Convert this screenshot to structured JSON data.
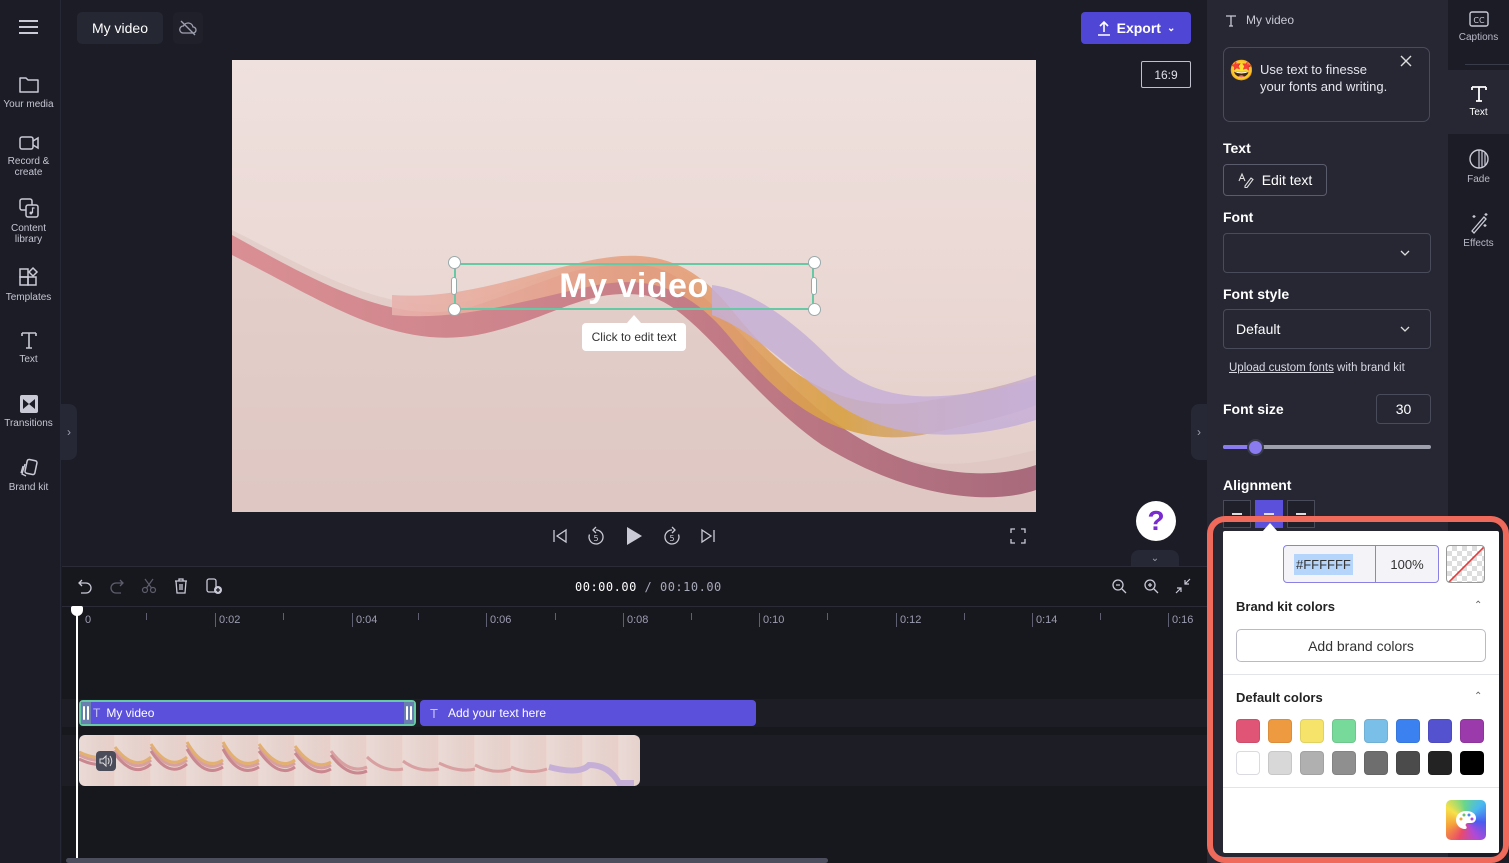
{
  "topbar": {
    "project_title": "My video",
    "cloud_status_icon": "cloud-off-icon",
    "export_label": "Export",
    "aspect_ratio": "16:9"
  },
  "leftnav": {
    "menu_icon": "hamburger-icon",
    "items": [
      {
        "label": "Your media",
        "icon": "folder-icon"
      },
      {
        "label": "Record & create",
        "icon": "video-camera-icon"
      },
      {
        "label": "Content library",
        "icon": "content-library-icon"
      },
      {
        "label": "Templates",
        "icon": "templates-icon"
      },
      {
        "label": "Text",
        "icon": "text-icon"
      },
      {
        "label": "Transitions",
        "icon": "transitions-icon"
      },
      {
        "label": "Brand kit",
        "icon": "brand-kit-icon"
      }
    ]
  },
  "preview": {
    "overlay_text": "My video",
    "tooltip": "Click to edit text"
  },
  "player": {
    "help_label": "?"
  },
  "timeline": {
    "current_time": "00:00.00",
    "total_time": "/ 00:10.00",
    "ruler_labels": [
      "0",
      "0:02",
      "0:04",
      "0:06",
      "0:08",
      "0:10",
      "0:12",
      "0:14",
      "0:16"
    ],
    "clips": {
      "text_clip_1": "My video",
      "text_clip_2": "Add your text here"
    }
  },
  "right_panel": {
    "header_title": "My video",
    "info_card_text": "Use text to finesse your fonts and writing.",
    "text_section_label": "Text",
    "edit_text_label": "Edit text",
    "font_label": "Font",
    "font_value": "",
    "font_style_label": "Font style",
    "font_style_value": "Default",
    "upload_fonts_link": "Upload custom fonts",
    "upload_fonts_suffix": " with brand kit",
    "font_size_label": "Font size",
    "font_size_value": "30",
    "font_size_slider_fraction": 0.16,
    "alignment_label": "Alignment",
    "alignment_selected": "center"
  },
  "right_tabs": [
    {
      "label": "Captions",
      "icon": "captions-icon",
      "active": false
    },
    {
      "label": "Text",
      "icon": "text-icon",
      "active": true
    },
    {
      "label": "Fade",
      "icon": "fade-icon",
      "active": false
    },
    {
      "label": "Effects",
      "icon": "effects-wand-icon",
      "active": false
    }
  ],
  "color_picker": {
    "hex_value": "#FFFFFF",
    "opacity_value": "100%",
    "brand_kit_title": "Brand kit colors",
    "add_brand_colors_label": "Add brand colors",
    "default_colors_title": "Default colors",
    "default_colors": [
      "#E05475",
      "#EE9A40",
      "#F5E36A",
      "#78DA9A",
      "#7ABFE8",
      "#3B82F0",
      "#5552CF",
      "#9B3AAA",
      "#FFFFFF",
      "#D8D8D8",
      "#B0B0B0",
      "#8F8F8F",
      "#6E6E6E",
      "#4B4B4B",
      "#232323",
      "#000000"
    ]
  },
  "colors": {
    "accent": "#5B50DC",
    "selection_outline": "#67C8A5",
    "highlight_ring": "#F06A5C"
  }
}
